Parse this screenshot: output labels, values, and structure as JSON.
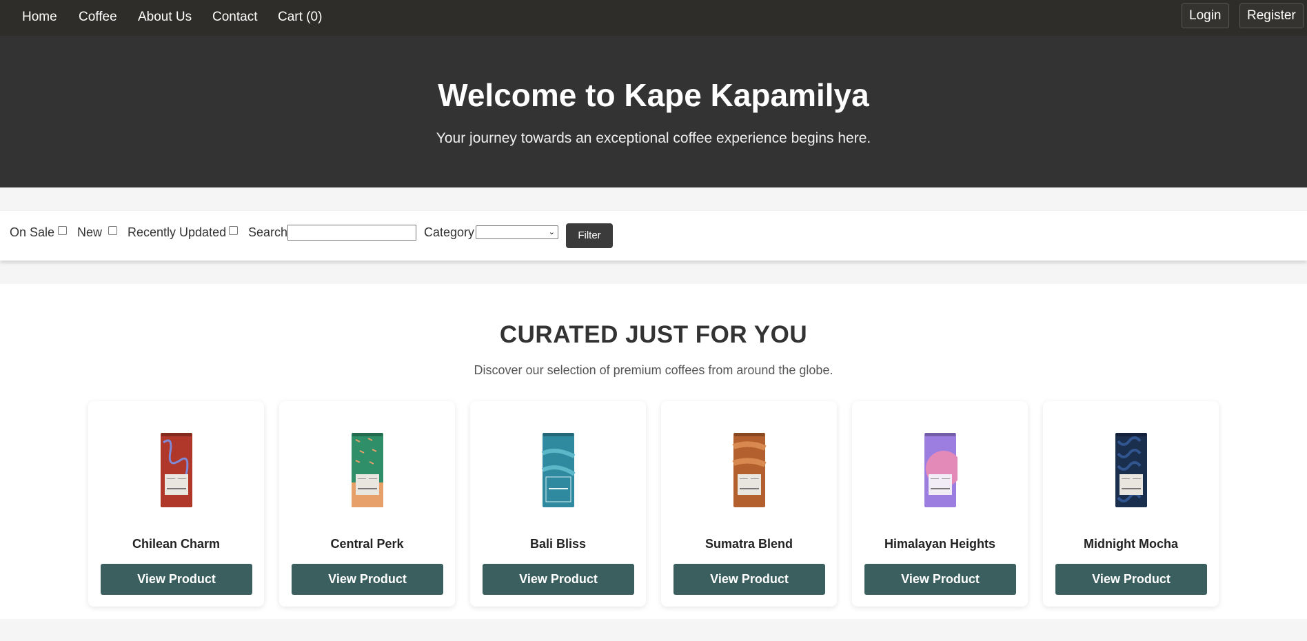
{
  "nav": {
    "links": [
      "Home",
      "Coffee",
      "About Us",
      "Contact",
      "Cart (0)"
    ],
    "login": "Login",
    "register": "Register"
  },
  "hero": {
    "title": "Welcome to Kape Kapamilya",
    "subtitle": "Your journey towards an exceptional coffee experience begins here."
  },
  "filters": {
    "on_sale": "On Sale",
    "new": "New",
    "recently_updated": "Recently Updated",
    "search": "Search",
    "search_value": "",
    "category": "Category",
    "category_value": "",
    "filter_button": "Filter"
  },
  "curated": {
    "title": "CURATED JUST FOR YOU",
    "subtitle": "Discover our selection of premium coffees from around the globe.",
    "button_label": "View Product",
    "products": [
      {
        "name": "Chilean Charm",
        "color": "#b0382a",
        "accent": "#7e8ad6"
      },
      {
        "name": "Central Perk",
        "color": "#2e8f68",
        "accent": "#e8a06a"
      },
      {
        "name": "Bali Bliss",
        "color": "#2f8aa0",
        "accent": "#5cb7c8"
      },
      {
        "name": "Sumatra Blend",
        "color": "#b4602e",
        "accent": "#d8894f"
      },
      {
        "name": "Himalayan Heights",
        "color": "#9c7ee0",
        "accent": "#e48ab8"
      },
      {
        "name": "Midnight Mocha",
        "color": "#1a2e4e",
        "accent": "#31558f"
      }
    ]
  },
  "colors": {
    "nav_bg": "#2f2d2a",
    "hero_bg": "#333333",
    "button_teal": "#3a5f5e"
  }
}
